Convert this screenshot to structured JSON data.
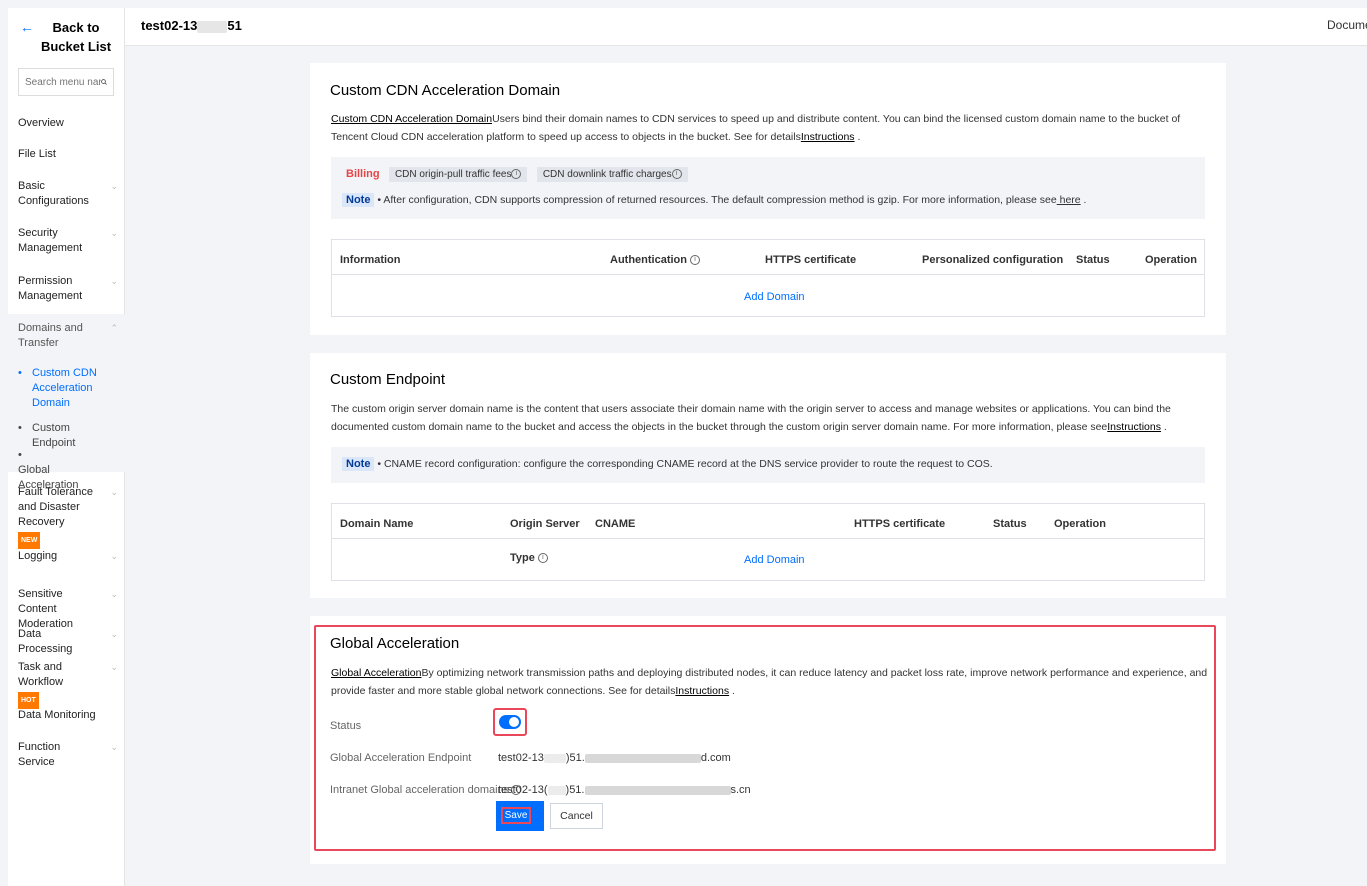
{
  "sidebar": {
    "back_label": "Back to Bucket List",
    "search_placeholder": "Search menu nam",
    "items": [
      {
        "label": "Overview"
      },
      {
        "label": "File List"
      },
      {
        "label": "Basic Configurations"
      },
      {
        "label": "Security Management"
      },
      {
        "label": "Permission Management"
      },
      {
        "label": "Domains and Transfer"
      },
      {
        "label": "Fault Tolerance and Disaster Recovery",
        "badge": "NEW"
      },
      {
        "label": "Logging"
      },
      {
        "label": "Sensitive Content Moderation"
      },
      {
        "label": "Data Processing"
      },
      {
        "label": "Task and Workflow",
        "badge": "HOT"
      },
      {
        "label": "Data Monitoring"
      },
      {
        "label": "Function Service"
      }
    ],
    "subitems": [
      {
        "label": "Custom CDN Acceleration Domain",
        "active": true
      },
      {
        "label": "Custom Endpoint"
      },
      {
        "label": "Global Acceleration"
      }
    ]
  },
  "topbar": {
    "bucket_prefix": "test02-13",
    "bucket_suffix": "51",
    "docs": "Docume"
  },
  "cdn": {
    "title": "Custom CDN Acceleration Domain",
    "desc_link": "Custom CDN Acceleration Domain",
    "desc_text": "Users bind their domain names to CDN services to speed up and distribute content. You can bind the licensed custom domain name to the bucket of Tencent Cloud CDN acceleration platform to speed up access to objects in the bucket. See for details",
    "desc_instr": "Instructions",
    "desc_end": " .",
    "billing_label": "Billing",
    "chip1": "CDN origin-pull traffic fees",
    "chip2": "CDN downlink traffic charges",
    "note_label": "Note",
    "note_text": "• After configuration, CDN supports compression of returned resources. The default compression method is gzip. For more information, please see",
    "note_link": " here",
    "note_end": " .",
    "headers": [
      "Information",
      "Authentication",
      "HTTPS certificate",
      "Personalized configuration",
      "Status",
      "Operation"
    ],
    "add_domain": "Add Domain"
  },
  "endpoint": {
    "title": "Custom Endpoint",
    "desc_text": "The custom origin server domain name is the content that users associate their domain name with the origin server to access and manage websites or applications. You can bind the documented custom domain name to the bucket and access the objects in the bucket through the custom origin server domain name. For more information, please see",
    "desc_instr": "Instructions",
    "desc_end": " .",
    "note_label": "Note",
    "note_text": "• CNAME record configuration: configure the corresponding CNAME record at the DNS service provider to route the request to COS.",
    "headers": [
      "Domain Name",
      "Origin Server",
      "CNAME",
      "HTTPS certificate",
      "Status",
      "Operation"
    ],
    "type_label": "Type",
    "add_domain": "Add Domain"
  },
  "global": {
    "title": "Global Acceleration",
    "desc_link": "Global Acceleration",
    "desc_text": "By optimizing network transmission paths and deploying distributed nodes, it can reduce latency and packet loss rate, improve network performance and experience, and provide faster and more stable global network connections. See for details",
    "desc_instr": "Instructions",
    "desc_end": " .",
    "status_label": "Status",
    "endpoint_label": "Global Acceleration Endpoint",
    "endpoint_prefix": "test02-13",
    "endpoint_mid": ")51.",
    "endpoint_suffix": "d.com",
    "intranet_label": "Intranet Global acceleration domains",
    "intranet_prefix": "test02-13(",
    "intranet_mid": ")51.",
    "intranet_suffix": "s.cn",
    "save": "Save",
    "cancel": "Cancel"
  },
  "colors": {
    "accent": "#006eff",
    "highlight": "#e8485a",
    "badge": "#ff7800"
  }
}
